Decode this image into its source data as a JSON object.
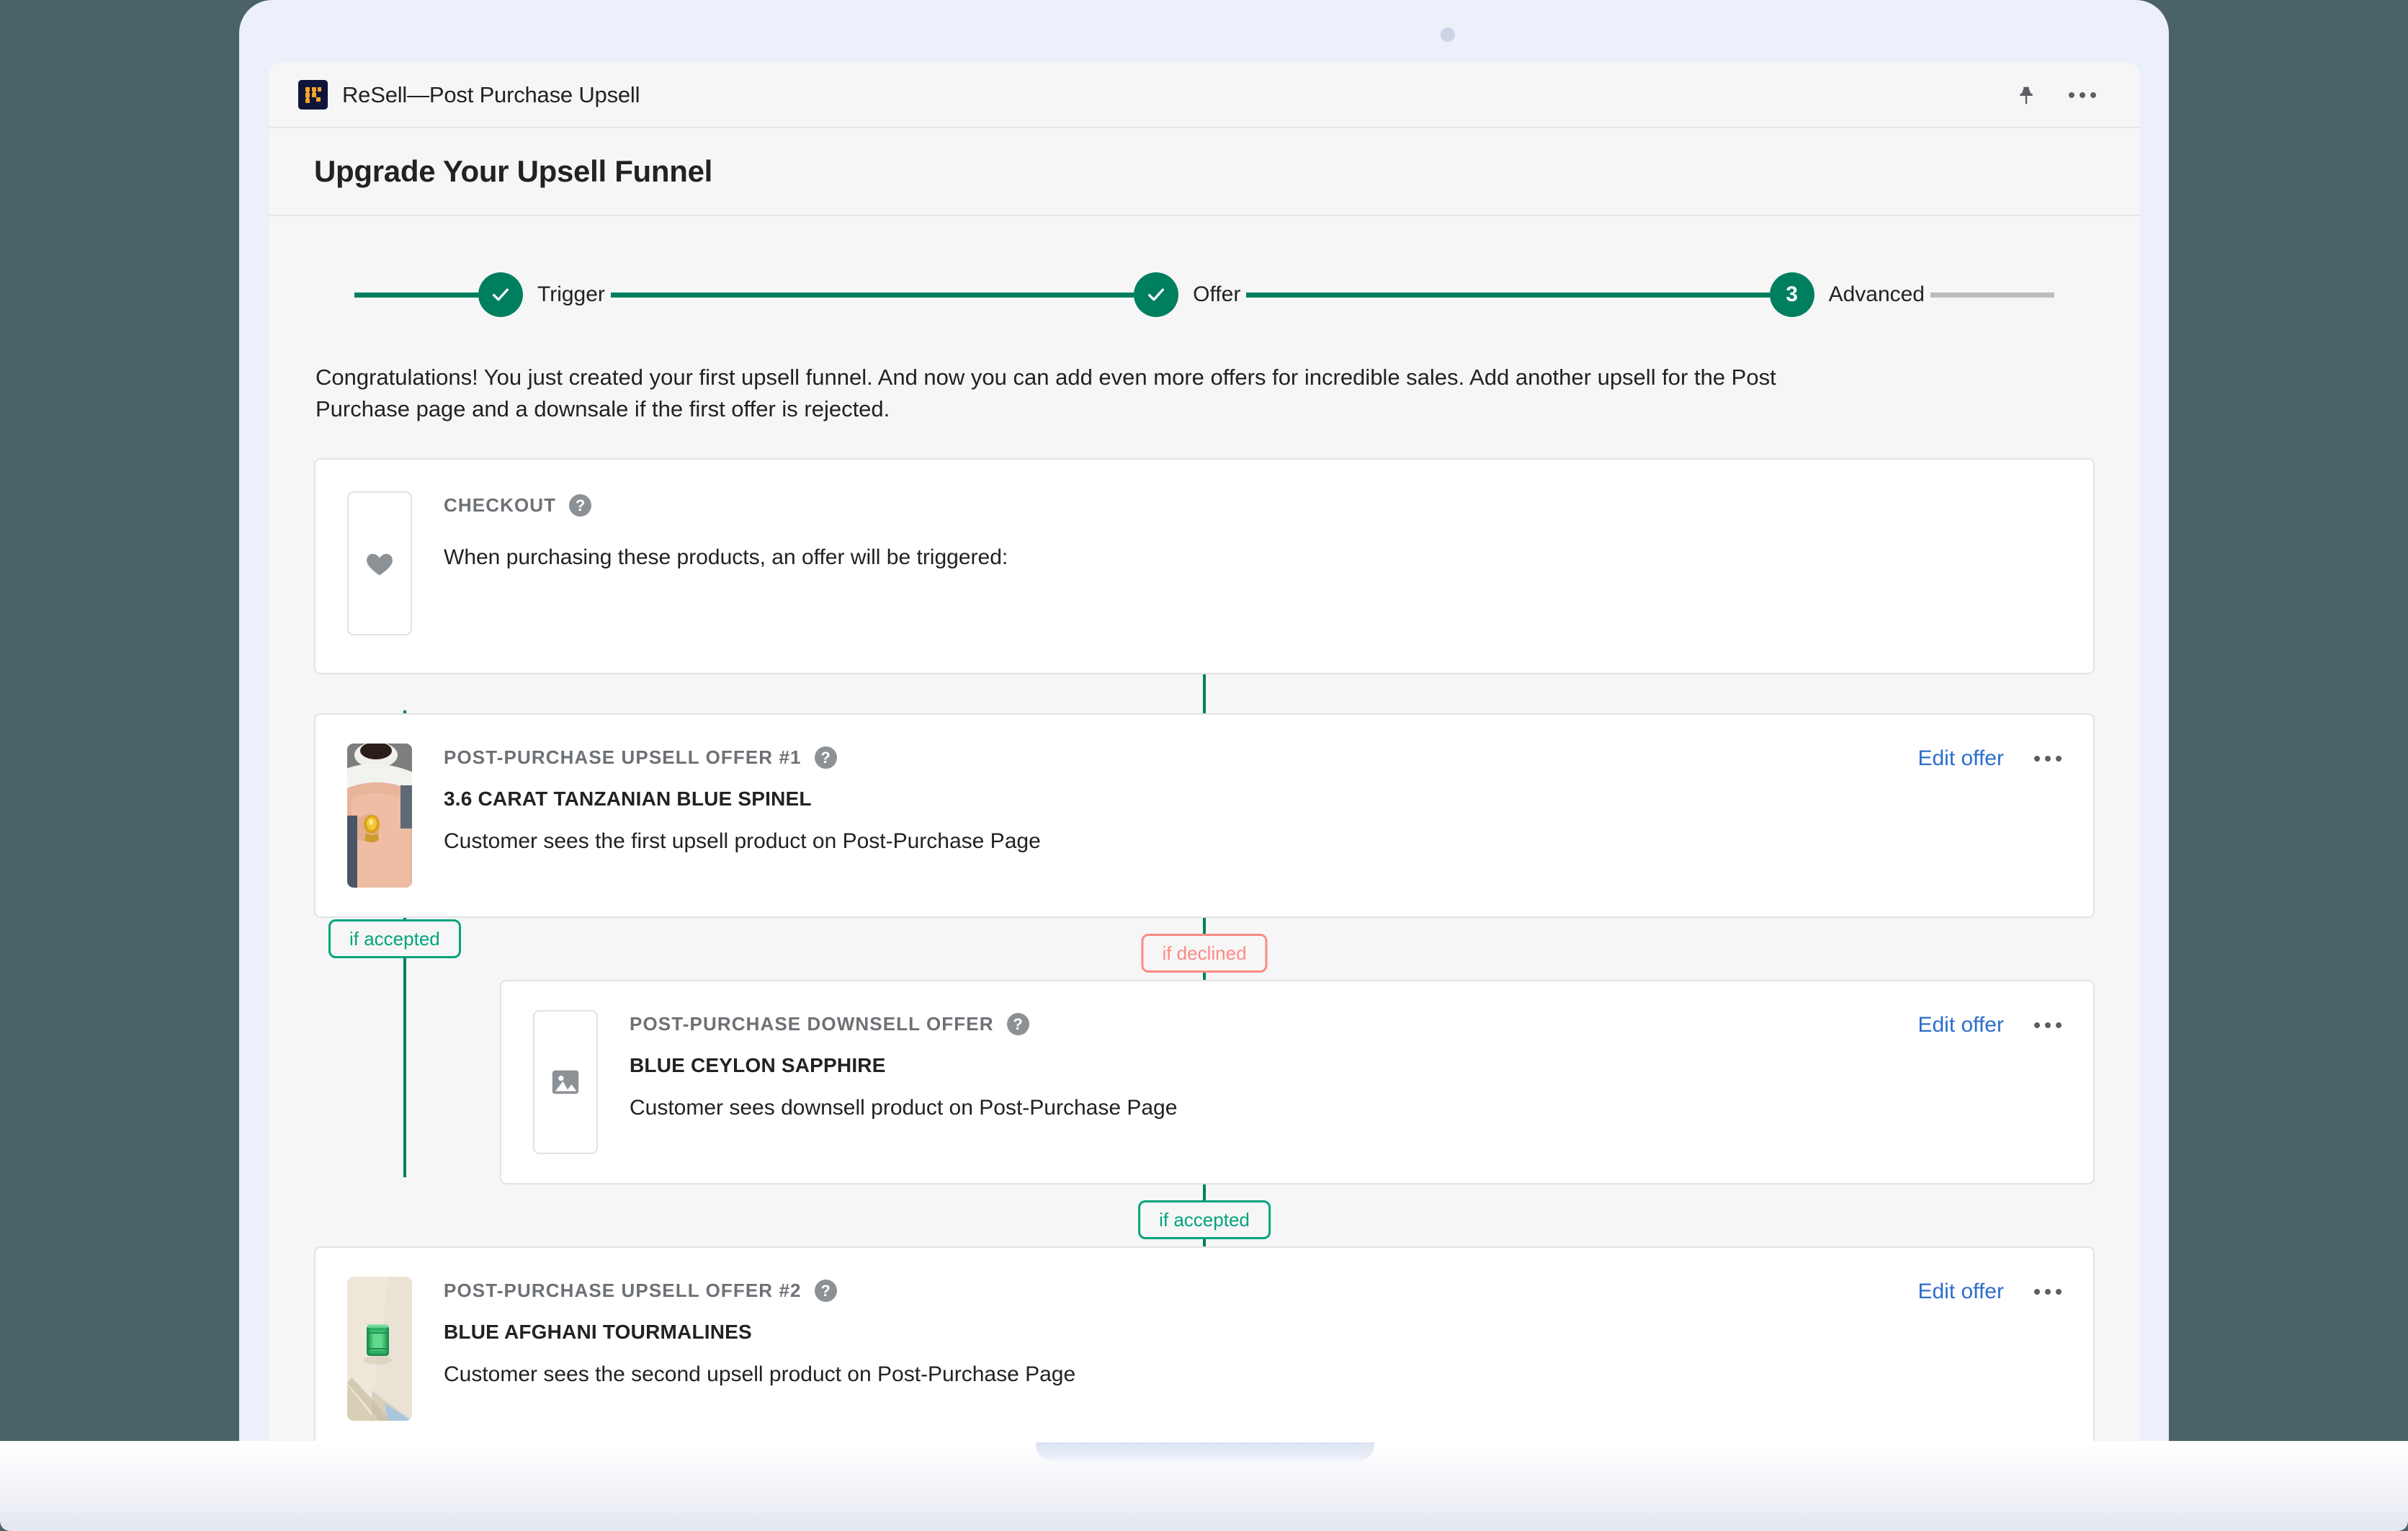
{
  "app": {
    "title": "ReSell—Post Purchase Upsell",
    "icon_name": "resell-app-icon",
    "pin_label": "Pin app",
    "more_label": "More actions"
  },
  "page": {
    "title": "Upgrade Your Upsell Funnel",
    "intro": "Congratulations! You just created your first upsell funnel. And now you can add even more offers for incredible sales. Add another upsell for the Post Purchase page and a downsale if the first offer is rejected."
  },
  "stepper": {
    "steps": [
      {
        "label": "Trigger",
        "marker": "✓",
        "state": "complete"
      },
      {
        "label": "Offer",
        "marker": "✓",
        "state": "complete"
      },
      {
        "label": "Advanced",
        "marker": "3",
        "state": "current"
      }
    ]
  },
  "colors": {
    "accent_green": "#007f5f",
    "accent_green_light": "#00a47c",
    "declined_red": "#fd8a82",
    "link_blue": "#2c6ecb",
    "muted_gray": "#bdbdbd"
  },
  "flow": {
    "checkout": {
      "kicker": "CHECKOUT",
      "help": "?",
      "description": "When purchasing these products, an offer will be triggered:",
      "thumb_icon": "heart-icon"
    },
    "upsell_1": {
      "kicker": "POST-PURCHASE UPSELL OFFER #1",
      "help": "?",
      "product": "3.6 CARAT TANZANIAN BLUE SPINEL",
      "description": "Customer sees the first upsell product on Post-Purchase Page",
      "thumb_icon": "ring-photo",
      "edit_label": "Edit offer",
      "more_label": "More actions"
    },
    "downsell": {
      "kicker": "POST-PURCHASE DOWNSELL OFFER",
      "help": "?",
      "product": "BLUE CEYLON SAPPHIRE",
      "description": "Customer sees downsell product on Post-Purchase Page",
      "thumb_icon": "image-placeholder-icon",
      "edit_label": "Edit offer",
      "more_label": "More actions"
    },
    "upsell_2": {
      "kicker": "POST-PURCHASE UPSELL OFFER #2",
      "help": "?",
      "product": "BLUE AFGHANI TOURMALINES",
      "description": "Customer sees the second upsell product on Post-Purchase Page",
      "thumb_icon": "gemstone-photo",
      "edit_label": "Edit offer",
      "more_label": "More actions"
    },
    "branches": {
      "declined": "if declined",
      "accepted_left": "if accepted",
      "accepted_center": "if accepted"
    }
  }
}
